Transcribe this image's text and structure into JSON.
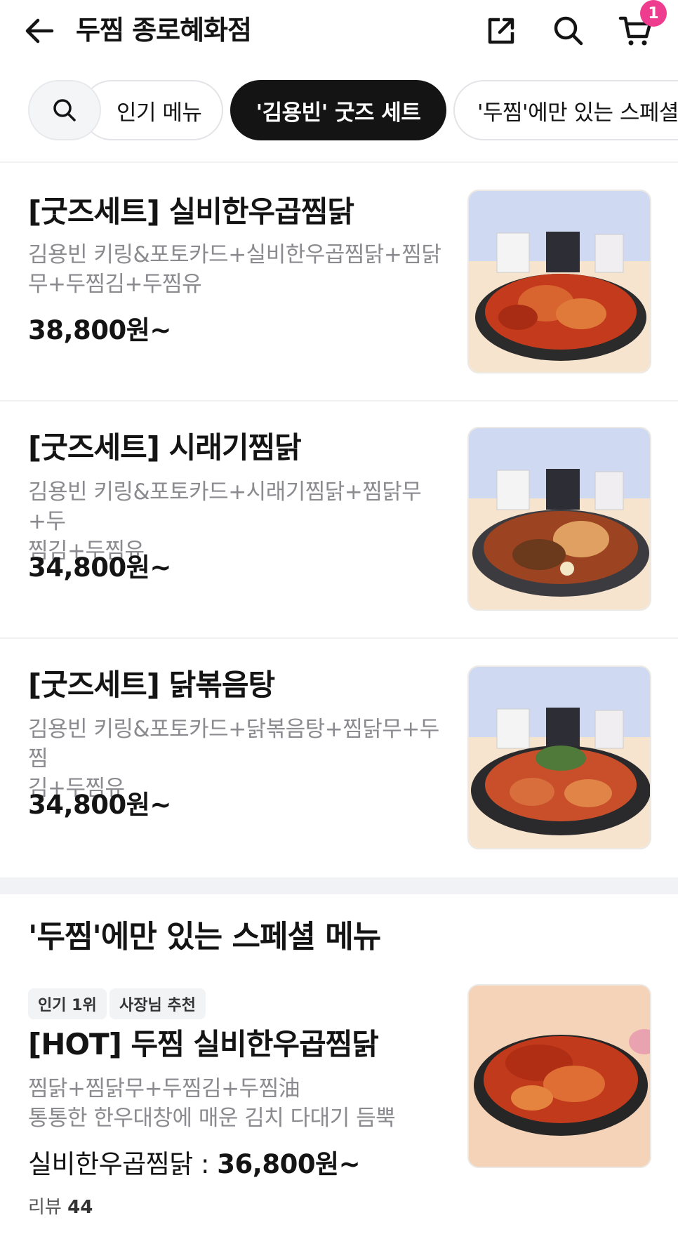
{
  "header": {
    "title": "두찜 종로혜화점",
    "cart_count": "1"
  },
  "chips": {
    "popular": "인기 메뉴",
    "goods_set": "'김용빈' 굿즈 세트",
    "special": "'두찜'에만 있는 스페셜 메뉴"
  },
  "items": [
    {
      "name": "[굿즈세트] 실비한우곱찜닭",
      "desc_line1": "김용빈 키링&포토카드+실비한우곱찜닭+찜닭",
      "desc_line2": "무+두찜김+두찜유",
      "price": "38,800원~"
    },
    {
      "name": "[굿즈세트] 시래기찜닭",
      "desc_line1": "김용빈 키링&포토카드+시래기찜닭+찜닭무+두",
      "desc_line2": "찜김+두찜유",
      "price": "34,800원~"
    },
    {
      "name": "[굿즈세트] 닭볶음탕",
      "desc_line1": "김용빈 키링&포토카드+닭볶음탕+찜닭무+두찜",
      "desc_line2": "김+두찜유",
      "price": "34,800원~"
    }
  ],
  "special_section": {
    "title": "'두찜'에만 있는 스페셜 메뉴",
    "badges": [
      "인기 1위",
      "사장님 추천"
    ],
    "item": {
      "name": "[HOT] 두찜 실비한우곱찜닭",
      "desc_line1": "찜닭+찜닭무+두찜김+두찜油",
      "desc_line2": "통통한 한우대창에 매운 김치 다대기 듬뿍",
      "price_label": "실비한우곱찜닭 : ",
      "price": "36,800원~",
      "review_label": "리뷰 ",
      "review_count": "44"
    }
  },
  "colors": {
    "badge_pink": "#ee3d8f",
    "active_chip": "#141414",
    "desc_gray": "#8a8a8f"
  }
}
